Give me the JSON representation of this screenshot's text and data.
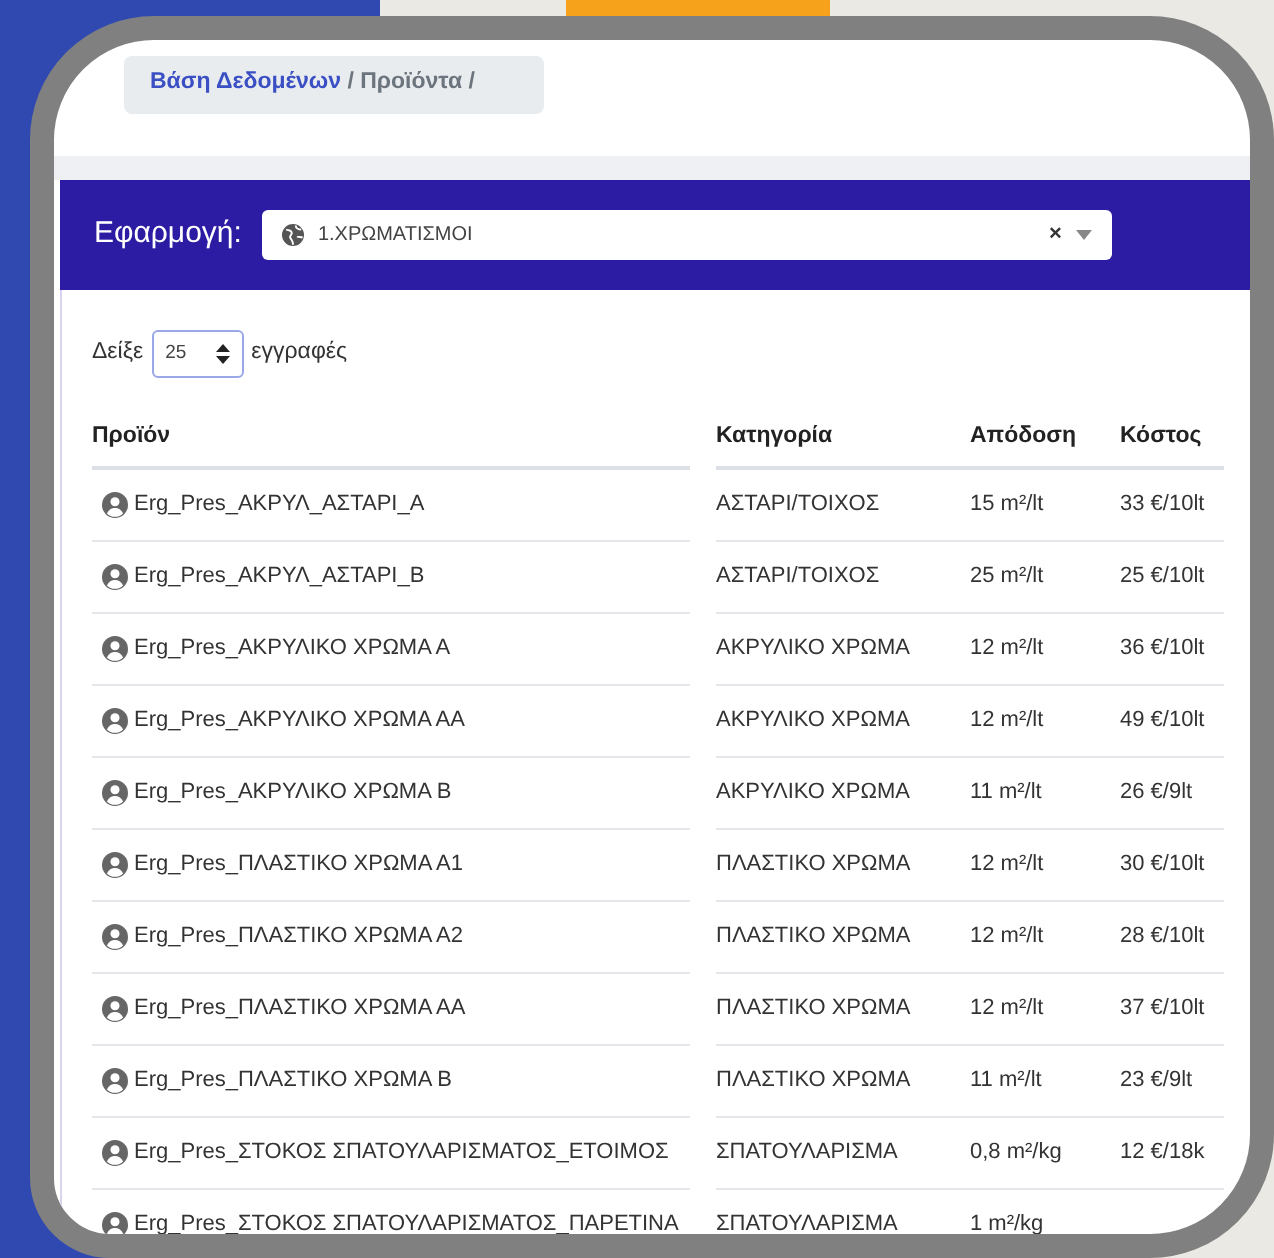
{
  "breadcrumb": [
    {
      "label": "Βάση Δεδομένων",
      "separator": "/",
      "active": false
    },
    {
      "label": "Προϊόντα",
      "separator": "/",
      "active": true
    }
  ],
  "filter": {
    "label": "Εφαρμογή:",
    "value": "1.ΧΡΩΜΑΤΙΣΜΟΙ",
    "clear": "×"
  },
  "page_length": {
    "before": "Δείξε",
    "value": "25",
    "after": "εγγραφές"
  },
  "table": {
    "columns": [
      "Προϊόν",
      "Κατηγορία",
      "Απόδοση",
      "Κόστος"
    ],
    "rows": [
      [
        "Erg_Pres_ΑΚΡΥΛ_ΑΣΤΑΡΙ_Α",
        "ΑΣΤΑΡΙ/ΤΟΙΧΟΣ",
        "15 m²/lt",
        "33 €/10lt"
      ],
      [
        "Erg_Pres_ΑΚΡΥΛ_ΑΣΤΑΡΙ_Β",
        "ΑΣΤΑΡΙ/ΤΟΙΧΟΣ",
        "25 m²/lt",
        "25 €/10lt"
      ],
      [
        "Erg_Pres_ΑΚΡΥΛΙΚΟ ΧΡΩΜΑ Α",
        "ΑΚΡΥΛΙΚΟ ΧΡΩΜΑ",
        "12 m²/lt",
        "36 €/10lt"
      ],
      [
        "Erg_Pres_ΑΚΡΥΛΙΚΟ ΧΡΩΜΑ ΑΑ",
        "ΑΚΡΥΛΙΚΟ ΧΡΩΜΑ",
        "12 m²/lt",
        "49 €/10lt"
      ],
      [
        "Erg_Pres_ΑΚΡΥΛΙΚΟ ΧΡΩΜΑ Β",
        "ΑΚΡΥΛΙΚΟ ΧΡΩΜΑ",
        "11 m²/lt",
        "26 €/9lt"
      ],
      [
        "Erg_Pres_ΠΛΑΣΤΙΚΟ ΧΡΩΜΑ Α1",
        "ΠΛΑΣΤΙΚΟ ΧΡΩΜΑ",
        "12 m²/lt",
        "30 €/10lt"
      ],
      [
        "Erg_Pres_ΠΛΑΣΤΙΚΟ ΧΡΩΜΑ Α2",
        "ΠΛΑΣΤΙΚΟ ΧΡΩΜΑ",
        "12 m²/lt",
        "28 €/10lt"
      ],
      [
        "Erg_Pres_ΠΛΑΣΤΙΚΟ ΧΡΩΜΑ ΑΑ",
        "ΠΛΑΣΤΙΚΟ ΧΡΩΜΑ",
        "12 m²/lt",
        "37 €/10lt"
      ],
      [
        "Erg_Pres_ΠΛΑΣΤΙΚΟ ΧΡΩΜΑ Β",
        "ΠΛΑΣΤΙΚΟ ΧΡΩΜΑ",
        "11 m²/lt",
        "23 €/9lt"
      ],
      [
        "Erg_Pres_ΣΤΟΚΟΣ ΣΠΑΤΟΥΛΑΡΙΣΜΑΤΟΣ_ΕΤΟΙΜΟΣ",
        "ΣΠΑΤΟΥΛΑΡΙΣΜΑ",
        "0,8 m²/kg",
        "12 €/18k"
      ],
      [
        "Erg_Pres_ΣΤΟΚΟΣ ΣΠΑΤΟΥΛΑΡΙΣΜΑΤΟΣ_ΠΑΡΕΤΙΝΑ",
        "ΣΠΑΤΟΥΛΑΡΙΣΜΑ",
        "1 m²/kg"
      ]
    ]
  }
}
